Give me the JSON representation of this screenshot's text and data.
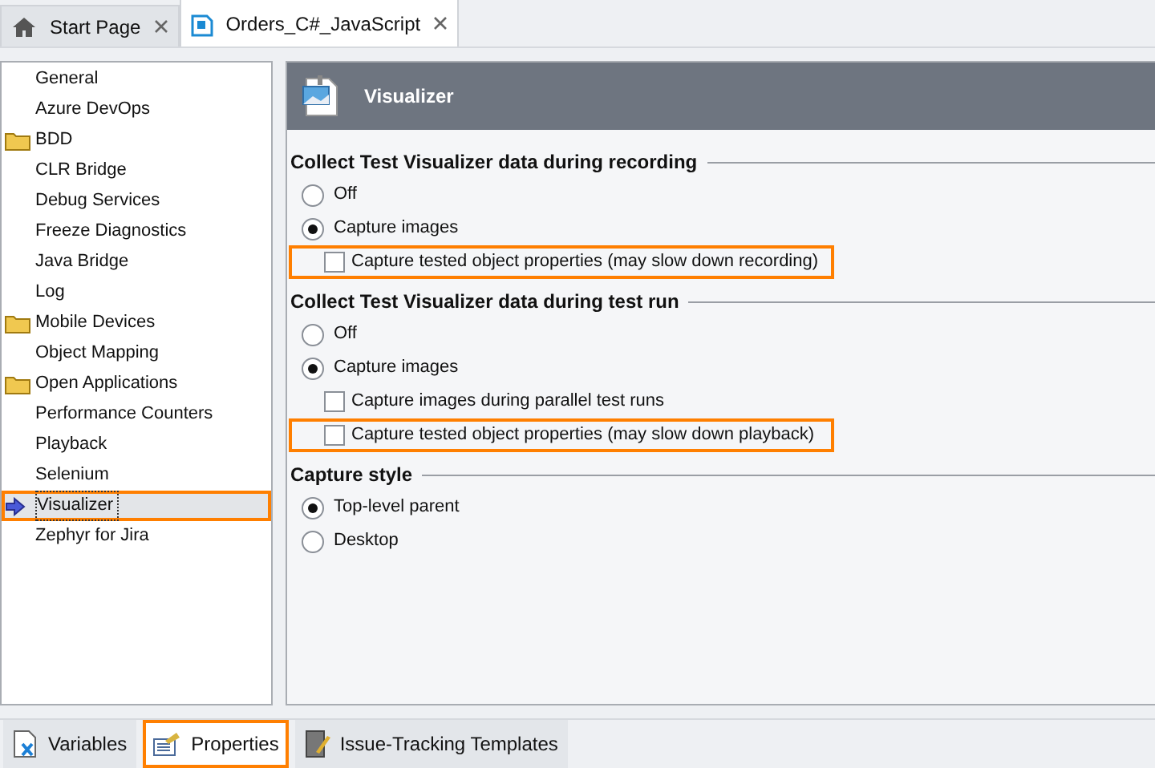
{
  "tabs": [
    {
      "label": "Start Page",
      "kind": "home",
      "selected": false
    },
    {
      "label": "Orders_C#_JavaScript",
      "kind": "project",
      "selected": true
    }
  ],
  "sidebar": {
    "items": [
      {
        "label": "General",
        "folder": false,
        "selected": false,
        "highlighted": false
      },
      {
        "label": "Azure DevOps",
        "folder": false,
        "selected": false,
        "highlighted": false
      },
      {
        "label": "BDD",
        "folder": true,
        "selected": false,
        "highlighted": false
      },
      {
        "label": "CLR Bridge",
        "folder": false,
        "selected": false,
        "highlighted": false
      },
      {
        "label": "Debug Services",
        "folder": false,
        "selected": false,
        "highlighted": false
      },
      {
        "label": "Freeze Diagnostics",
        "folder": false,
        "selected": false,
        "highlighted": false
      },
      {
        "label": "Java Bridge",
        "folder": false,
        "selected": false,
        "highlighted": false
      },
      {
        "label": "Log",
        "folder": false,
        "selected": false,
        "highlighted": false
      },
      {
        "label": "Mobile Devices",
        "folder": true,
        "selected": false,
        "highlighted": false
      },
      {
        "label": "Object Mapping",
        "folder": false,
        "selected": false,
        "highlighted": false
      },
      {
        "label": "Open Applications",
        "folder": true,
        "selected": false,
        "highlighted": false
      },
      {
        "label": "Performance Counters",
        "folder": false,
        "selected": false,
        "highlighted": false
      },
      {
        "label": "Playback",
        "folder": false,
        "selected": false,
        "highlighted": false
      },
      {
        "label": "Selenium",
        "folder": false,
        "selected": false,
        "highlighted": false
      },
      {
        "label": "Visualizer",
        "folder": false,
        "selected": true,
        "highlighted": true
      },
      {
        "label": "Zephyr for Jira",
        "folder": false,
        "selected": false,
        "highlighted": false
      }
    ]
  },
  "panel": {
    "title": "Visualizer",
    "sections": [
      {
        "title": "Collect Test Visualizer data during recording",
        "options": [
          {
            "kind": "radio",
            "label": "Off",
            "selected": false,
            "highlighted": false
          },
          {
            "kind": "radio",
            "label": "Capture images",
            "selected": true,
            "highlighted": false
          },
          {
            "kind": "checkbox",
            "label": "Capture tested object properties (may slow down recording)",
            "checked": false,
            "highlighted": true
          }
        ]
      },
      {
        "title": "Collect Test Visualizer data during test run",
        "options": [
          {
            "kind": "radio",
            "label": "Off",
            "selected": false,
            "highlighted": false
          },
          {
            "kind": "radio",
            "label": "Capture images",
            "selected": true,
            "highlighted": false
          },
          {
            "kind": "checkbox",
            "label": "Capture images during parallel test runs",
            "checked": false,
            "highlighted": false
          },
          {
            "kind": "checkbox",
            "label": "Capture tested object properties (may slow down playback)",
            "checked": false,
            "highlighted": true
          }
        ]
      },
      {
        "title": "Capture style",
        "options": [
          {
            "kind": "radio",
            "label": "Top-level parent",
            "selected": true,
            "highlighted": false
          },
          {
            "kind": "radio",
            "label": "Desktop",
            "selected": false,
            "highlighted": false
          }
        ]
      }
    ]
  },
  "bottom_tabs": [
    {
      "label": "Variables",
      "kind": "variables",
      "selected": false,
      "highlighted": false
    },
    {
      "label": "Properties",
      "kind": "properties",
      "selected": true,
      "highlighted": true
    },
    {
      "label": "Issue-Tracking Templates",
      "kind": "templates",
      "selected": false,
      "highlighted": false
    }
  ]
}
